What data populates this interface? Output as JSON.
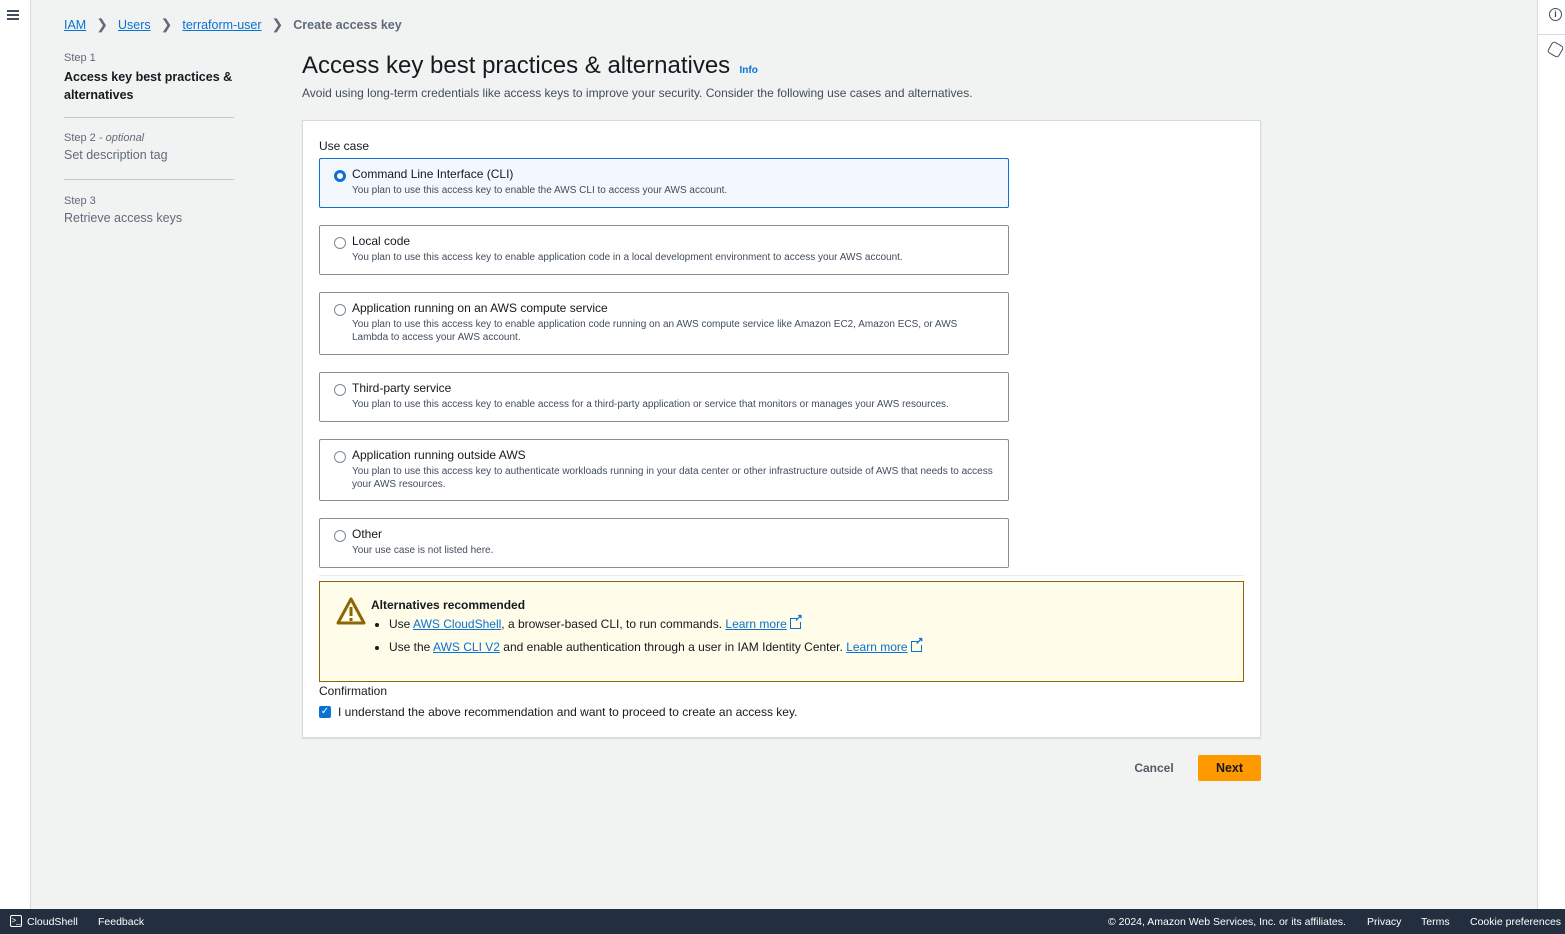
{
  "breadcrumbs": [
    "IAM",
    "Users",
    "terraform-user",
    "Create access key"
  ],
  "steps": [
    {
      "label": "Step 1",
      "title": "Access key best practices & alternatives"
    },
    {
      "label": "Step 2",
      "optional": "- optional",
      "title": "Set description tag"
    },
    {
      "label": "Step 3",
      "title": "Retrieve access keys"
    }
  ],
  "header": {
    "title": "Access key best practices & alternatives",
    "info": "Info",
    "description": "Avoid using long-term credentials like access keys to improve your security. Consider the following use cases and alternatives."
  },
  "use_case": {
    "label": "Use case",
    "selected": 0,
    "options": [
      {
        "title": "Command Line Interface (CLI)",
        "desc": "You plan to use this access key to enable the AWS CLI to access your AWS account."
      },
      {
        "title": "Local code",
        "desc": "You plan to use this access key to enable application code in a local development environment to access your AWS account."
      },
      {
        "title": "Application running on an AWS compute service",
        "desc": "You plan to use this access key to enable application code running on an AWS compute service like Amazon EC2, Amazon ECS, or AWS Lambda to access your AWS account."
      },
      {
        "title": "Third-party service",
        "desc": "You plan to use this access key to enable access for a third-party application or service that monitors or manages your AWS resources."
      },
      {
        "title": "Application running outside AWS",
        "desc": "You plan to use this access key to authenticate workloads running in your data center or other infrastructure outside of AWS that needs to access your AWS resources."
      },
      {
        "title": "Other",
        "desc": "Your use case is not listed here."
      }
    ]
  },
  "alert": {
    "title": "Alternatives recommended",
    "item1": {
      "pre": "Use ",
      "link": "AWS CloudShell",
      "post": ", a browser-based CLI, to run commands. ",
      "learn": "Learn more"
    },
    "item2": {
      "pre": "Use the ",
      "link": "AWS CLI V2",
      "post": " and enable authentication through a user in IAM Identity Center. ",
      "learn": "Learn more"
    }
  },
  "confirmation": {
    "label": "Confirmation",
    "checkbox": "I understand the above recommendation and want to proceed to create an access key.",
    "checked": true
  },
  "actions": {
    "cancel": "Cancel",
    "next": "Next"
  },
  "footer": {
    "cloudshell": "CloudShell",
    "feedback": "Feedback",
    "copyright": "© 2024, Amazon Web Services, Inc. or its affiliates.",
    "privacy": "Privacy",
    "terms": "Terms",
    "cookies": "Cookie preferences"
  }
}
